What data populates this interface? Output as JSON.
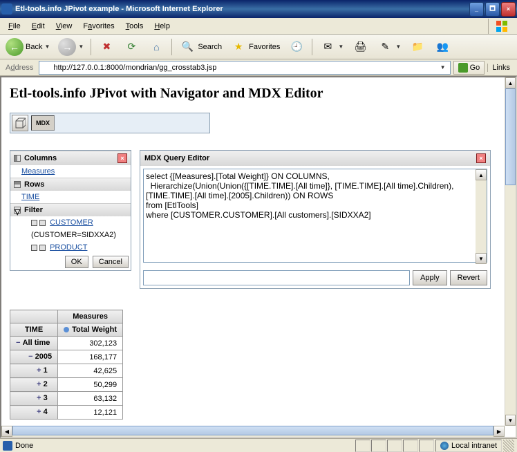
{
  "window": {
    "title": "Etl-tools.info JPivot example - Microsoft Internet Explorer",
    "min": "_",
    "max": "🗖",
    "close": "×"
  },
  "menu": {
    "file": "File",
    "edit": "Edit",
    "view": "View",
    "favorites": "Favorites",
    "tools": "Tools",
    "help": "Help"
  },
  "toolbar": {
    "back": "Back",
    "search": "Search",
    "favorites": "Favorites"
  },
  "address": {
    "label": "Address",
    "url": "http://127.0.0.1:8000/mondrian/gg_crosstab3.jsp",
    "go": "Go",
    "links": "Links"
  },
  "page": {
    "heading": "Etl-tools.info JPivot with Navigator and MDX Editor",
    "mdx_btn": "MDX"
  },
  "nav": {
    "columns": "Columns",
    "measures": "Measures",
    "rows": "Rows",
    "time": "TIME",
    "filter": "Filter",
    "customer": "CUSTOMER",
    "customer_detail": "(CUSTOMER=SIDXXA2)",
    "product": "PRODUCT",
    "ok": "OK",
    "cancel": "Cancel",
    "close": "×"
  },
  "mdx": {
    "title": "MDX Query Editor",
    "query": "select {[Measures].[Total Weight]} ON COLUMNS,\n  Hierarchize(Union(Union({[TIME.TIME].[All time]}, [TIME.TIME].[All time].Children), [TIME.TIME].[All time].[2005].Children)) ON ROWS\nfrom [EtlTools]\nwhere [CUSTOMER.CUSTOMER].[All customers].[SIDXXA2]",
    "apply": "Apply",
    "revert": "Revert",
    "close": "×"
  },
  "table": {
    "measures_hdr": "Measures",
    "time_hdr": "TIME",
    "col1": "Total Weight",
    "rows": [
      {
        "drill": "−",
        "label": "All time",
        "value": "302,123",
        "lvl": 0
      },
      {
        "drill": "−",
        "label": "2005",
        "value": "168,177",
        "lvl": 1
      },
      {
        "drill": "+",
        "label": "1",
        "value": "42,625",
        "lvl": 2
      },
      {
        "drill": "+",
        "label": "2",
        "value": "50,299",
        "lvl": 2
      },
      {
        "drill": "+",
        "label": "3",
        "value": "63,132",
        "lvl": 2
      },
      {
        "drill": "+",
        "label": "4",
        "value": "12,121",
        "lvl": 2
      }
    ]
  },
  "status": {
    "done": "Done",
    "zone": "Local intranet"
  }
}
